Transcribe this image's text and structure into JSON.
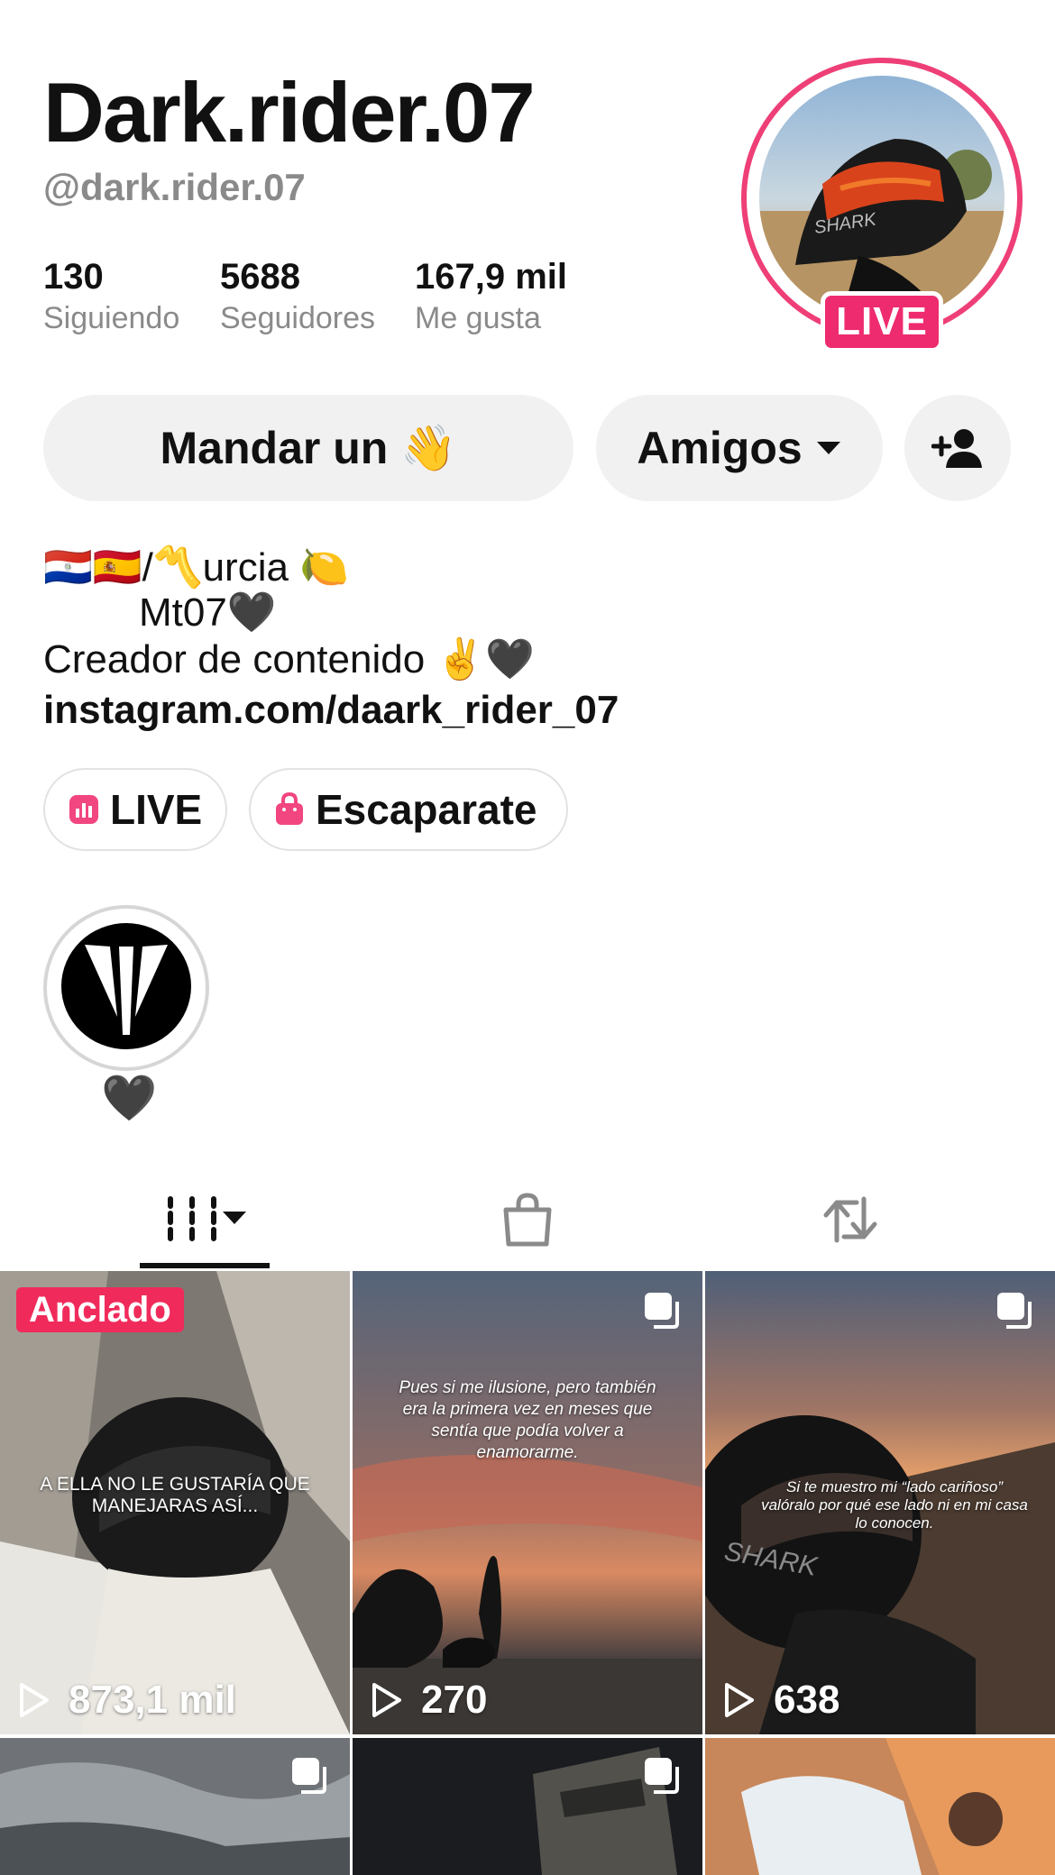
{
  "profile": {
    "display_name": "Dark.rider.07",
    "handle": "@dark.rider.07",
    "live_badge": "LIVE"
  },
  "stats": [
    {
      "value": "130",
      "label": "Siguiendo"
    },
    {
      "value": "5688",
      "label": "Seguidores"
    },
    {
      "value": "167,9 mil",
      "label": "Me gusta"
    }
  ],
  "actions": {
    "message": "Mandar un 👋",
    "friends": "Amigos",
    "add_friend_icon": "person-add-icon"
  },
  "bio": {
    "line1": "🇵🇾🇪🇸/〽️urcia 🍋",
    "line2": "Mt07🖤",
    "line3": "Creador de contenido ✌️🖤",
    "link": "instagram.com/daark_rider_07"
  },
  "pills": {
    "live": "LIVE",
    "shop": "Escaparate"
  },
  "highlight": {
    "label": "🖤"
  },
  "tabs": [
    {
      "icon": "videos-grid-icon",
      "active": true
    },
    {
      "icon": "shopping-bag-icon",
      "active": false
    },
    {
      "icon": "repost-icon",
      "active": false
    }
  ],
  "videos": [
    {
      "views": "873,1 mil",
      "pinned": "Anclado",
      "caption": "A ELLA NO LE GUSTARÍA QUE MANEJARAS ASÍ..."
    },
    {
      "views": "270",
      "caption": "Pues si me ilusione, pero también era la primera vez en meses que sentía que podía volver a enamorarme."
    },
    {
      "views": "638",
      "caption": "Si te muestro mi “lado cariñoso” valóralo por qué ese lado ni en mi casa lo conocen."
    }
  ],
  "colors": {
    "accent": "#ee2b6f",
    "pinned": "#f02b5b",
    "muted_text": "#8a8a8a",
    "button_bg": "#f1f1f2"
  }
}
